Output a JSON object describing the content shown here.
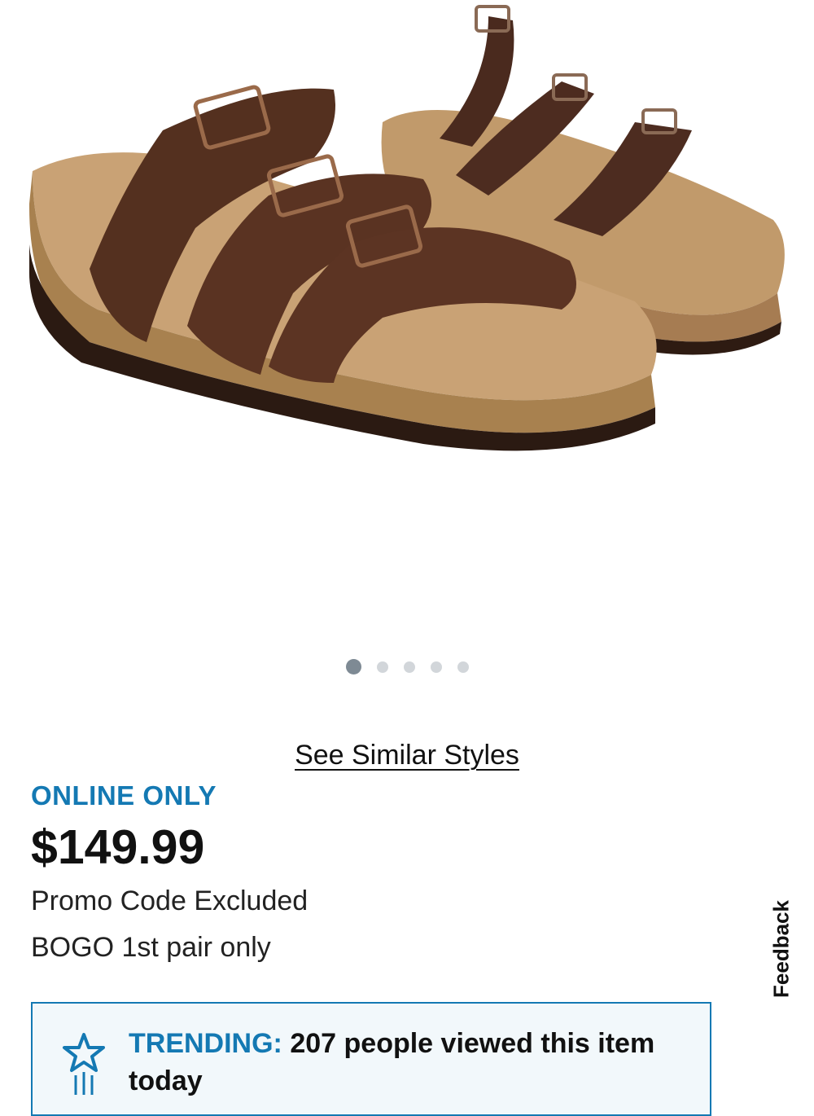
{
  "product": {
    "image_name": "sandal-product-image",
    "carousel": {
      "count": 5,
      "active_index": 0
    }
  },
  "links": {
    "see_similar": "See Similar Styles"
  },
  "pricing": {
    "availability": "ONLINE ONLY",
    "price": "$149.99",
    "promo_note": "Promo Code Excluded",
    "bogo_note": "BOGO 1st pair only"
  },
  "feedback": {
    "label": "Feedback"
  },
  "trending": {
    "label": "TRENDING:",
    "message": "207 people viewed this item today"
  },
  "colors": {
    "accent": "#1479b3",
    "dot_active": "#7e8a94",
    "dot_inactive": "#d2d6da"
  }
}
